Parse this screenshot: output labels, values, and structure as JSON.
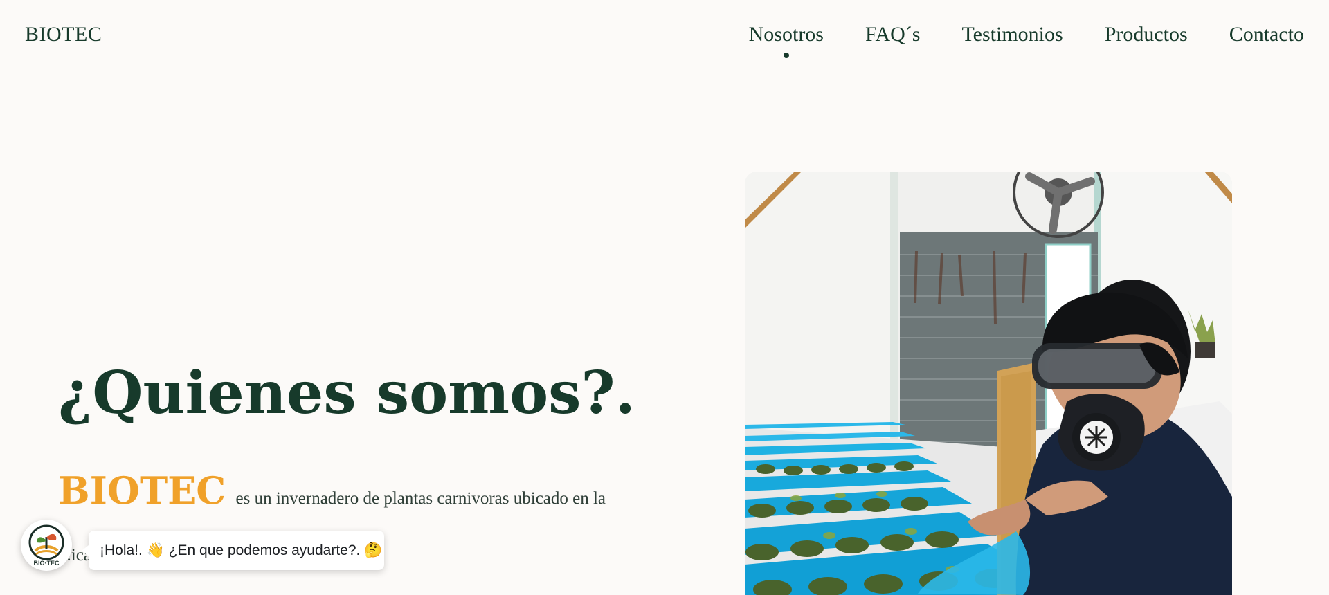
{
  "header": {
    "brand": "BIOTEC",
    "nav": [
      {
        "label": "Nosotros",
        "active": true
      },
      {
        "label": "FAQ´s",
        "active": false
      },
      {
        "label": "Testimonios",
        "active": false
      },
      {
        "label": "Productos",
        "active": false
      },
      {
        "label": "Contacto",
        "active": false
      }
    ]
  },
  "hero": {
    "title": "¿Quienes somos?.",
    "highlight": "BIOTEC",
    "body": "es un invernadero de plantas carnivoras ubicado en la ...ica ... ma de especímenes fundado el",
    "image_alt": "Persona con gafas y mascarilla de protección revisando plantas carnívoras en bandejas azules dentro de un invernadero"
  },
  "chat": {
    "logo_text": "BIO·TEC",
    "message": "¡Hola!. 👋 ¿En que podemos ayudarte?. 🤔"
  },
  "colors": {
    "primary": "#173a2b",
    "accent": "#f0a12a",
    "background": "#fcfaf8",
    "tray_blue": "#2bb8e9"
  },
  "icons": {
    "wave": "wave-hand-icon",
    "thinking": "thinking-face-icon"
  }
}
